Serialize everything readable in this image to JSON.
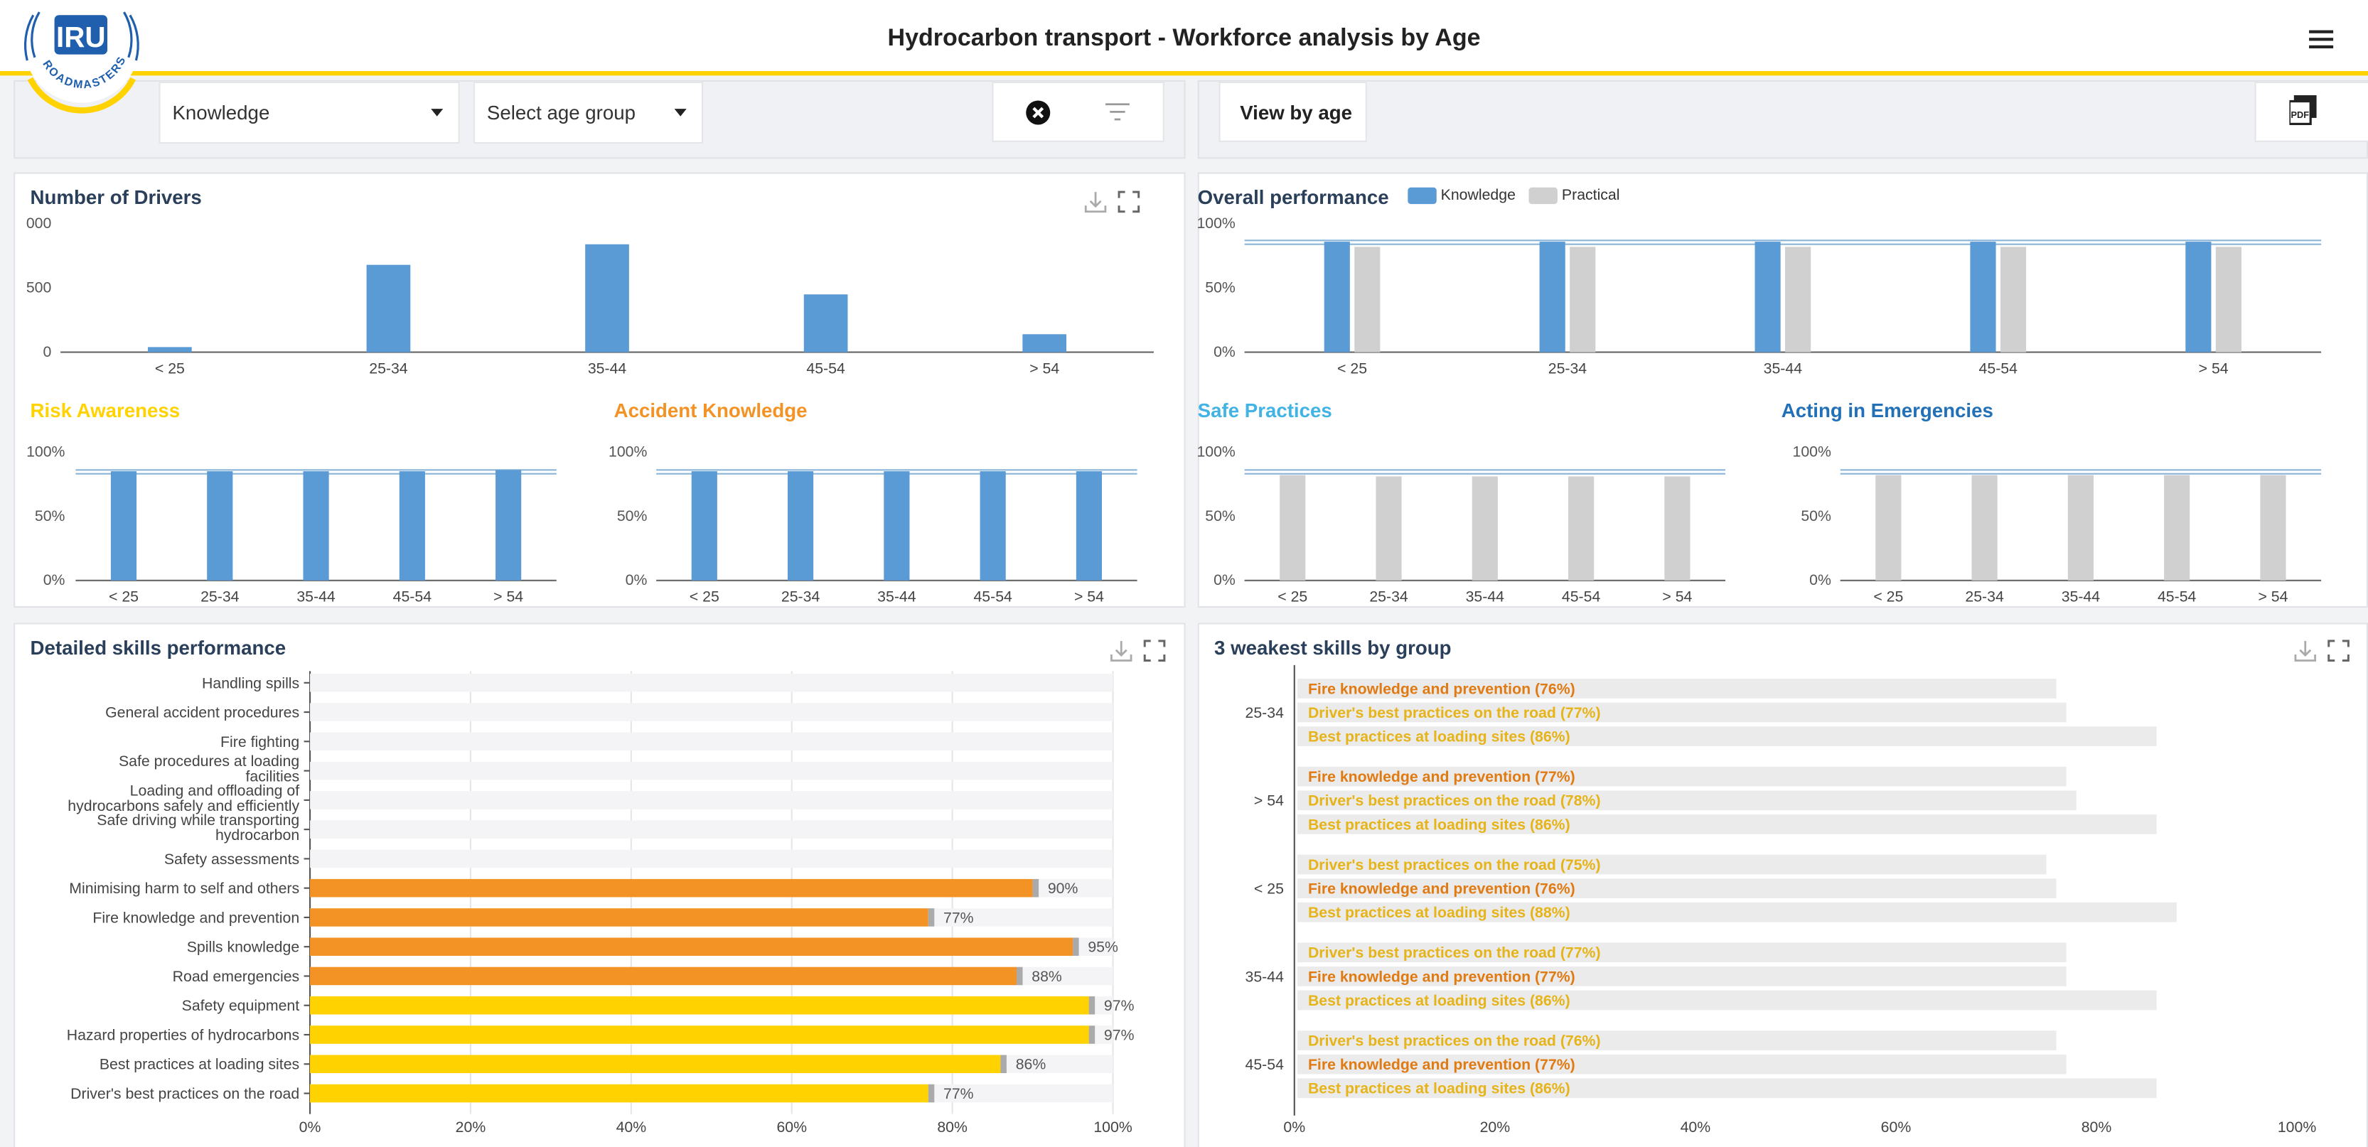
{
  "app": {
    "title": "Hydrocarbon transport - Workforce analysis by Age",
    "logo_text": "IRU",
    "logo_sub": "ROADMASTERS"
  },
  "filters": {
    "category": "Knowledge",
    "age_placeholder": "Select age group",
    "view_by_age": "View by age"
  },
  "colors": {
    "blue": "#5b9bd5",
    "gray": "#d0d0d0",
    "orange": "#f39325",
    "yellow": "#ffd200",
    "risk": "#ffd200",
    "accident": "#f39325",
    "safe": "#42b3e5",
    "emergency": "#2271b8"
  },
  "number_of_drivers": {
    "title": "Number of Drivers",
    "chart_data": {
      "type": "bar",
      "categories": [
        "< 25",
        "25-34",
        "35-44",
        "45-54",
        "> 54"
      ],
      "values": [
        40,
        680,
        840,
        450,
        140
      ],
      "ylim": [
        0,
        1000
      ],
      "yticks": [
        "0",
        "500",
        "000"
      ]
    }
  },
  "overall_performance": {
    "title": "Overall performance",
    "legend": [
      "Knowledge",
      "Practical"
    ],
    "chart_data": {
      "type": "bar",
      "categories": [
        "< 25",
        "25-34",
        "35-44",
        "45-54",
        "> 54"
      ],
      "series": [
        {
          "name": "Knowledge",
          "values": [
            86,
            86,
            86,
            86,
            86
          ]
        },
        {
          "name": "Practical",
          "values": [
            82,
            82,
            82,
            82,
            82
          ]
        }
      ],
      "ylim": [
        0,
        100
      ],
      "yticks": [
        "0%",
        "50%",
        "100%"
      ],
      "reference_lines": [
        87,
        84
      ]
    }
  },
  "small_charts": [
    {
      "title": "Risk Awareness",
      "color_key": "risk",
      "bar_color": "#5b9bd5",
      "chart_data": {
        "type": "bar",
        "categories": [
          "< 25",
          "25-34",
          "35-44",
          "45-54",
          "> 54"
        ],
        "values": [
          85,
          85,
          85,
          85,
          86
        ],
        "ylim": [
          0,
          100
        ],
        "yticks": [
          "0%",
          "50%",
          "100%"
        ],
        "reference_lines": [
          86,
          83
        ]
      }
    },
    {
      "title": "Accident Knowledge",
      "color_key": "accident",
      "bar_color": "#5b9bd5",
      "chart_data": {
        "type": "bar",
        "categories": [
          "< 25",
          "25-34",
          "35-44",
          "45-54",
          "> 54"
        ],
        "values": [
          85,
          85,
          85,
          85,
          85
        ],
        "ylim": [
          0,
          100
        ],
        "yticks": [
          "0%",
          "50%",
          "100%"
        ],
        "reference_lines": [
          86,
          83
        ]
      }
    },
    {
      "title": "Safe Practices",
      "color_key": "safe",
      "bar_color": "#d0d0d0",
      "chart_data": {
        "type": "bar",
        "categories": [
          "< 25",
          "25-34",
          "35-44",
          "45-54",
          "> 54"
        ],
        "values": [
          82,
          81,
          81,
          81,
          81
        ],
        "ylim": [
          0,
          100
        ],
        "yticks": [
          "0%",
          "50%",
          "100%"
        ],
        "reference_lines": [
          86,
          83
        ]
      }
    },
    {
      "title": "Acting in Emergencies",
      "color_key": "emergency",
      "bar_color": "#d0d0d0",
      "chart_data": {
        "type": "bar",
        "categories": [
          "< 25",
          "25-34",
          "35-44",
          "45-54",
          "> 54"
        ],
        "values": [
          82,
          82,
          82,
          82,
          82
        ],
        "ylim": [
          0,
          100
        ],
        "yticks": [
          "0%",
          "50%",
          "100%"
        ],
        "reference_lines": [
          86,
          83
        ]
      }
    }
  ],
  "detailed_skills": {
    "title": "Detailed skills performance",
    "chart_data": {
      "type": "bar",
      "orientation": "horizontal",
      "xticks": [
        "0%",
        "20%",
        "40%",
        "60%",
        "80%",
        "100%"
      ],
      "xlim": [
        0,
        100
      ],
      "rows": [
        {
          "label": [
            "Handling spills"
          ],
          "value": null,
          "color": "orange"
        },
        {
          "label": [
            "General accident procedures"
          ],
          "value": null,
          "color": "orange"
        },
        {
          "label": [
            "Fire fighting"
          ],
          "value": null,
          "color": "orange"
        },
        {
          "label": [
            "Safe procedures at loading",
            "facilities"
          ],
          "value": null,
          "color": "orange"
        },
        {
          "label": [
            "Loading and offloading of",
            "hydrocarbons safely and efficiently"
          ],
          "value": null,
          "color": "orange"
        },
        {
          "label": [
            "Safe driving while transporting",
            "hydrocarbon"
          ],
          "value": null,
          "color": "orange"
        },
        {
          "label": [
            "Safety assessments"
          ],
          "value": null,
          "color": "orange"
        },
        {
          "label": [
            "Minimising harm to self and others"
          ],
          "value": 90,
          "text": "90%",
          "color": "orange"
        },
        {
          "label": [
            "Fire knowledge and prevention"
          ],
          "value": 77,
          "text": "77%",
          "color": "orange"
        },
        {
          "label": [
            "Spills knowledge"
          ],
          "value": 95,
          "text": "95%",
          "color": "orange"
        },
        {
          "label": [
            "Road emergencies"
          ],
          "value": 88,
          "text": "88%",
          "color": "orange"
        },
        {
          "label": [
            "Safety equipment"
          ],
          "value": 97,
          "text": "97%",
          "color": "yellow"
        },
        {
          "label": [
            "Hazard properties of hydrocarbons"
          ],
          "value": 97,
          "text": "97%",
          "color": "yellow"
        },
        {
          "label": [
            "Best practices at loading sites"
          ],
          "value": 86,
          "text": "86%",
          "color": "yellow"
        },
        {
          "label": [
            "Driver's best practices on the road"
          ],
          "value": 77,
          "text": "77%",
          "color": "yellow"
        }
      ]
    }
  },
  "weakest_skills": {
    "title": "3 weakest skills by group",
    "chart_data": {
      "type": "bar",
      "orientation": "horizontal",
      "xticks": [
        "0%",
        "20%",
        "40%",
        "60%",
        "80%",
        "100%"
      ],
      "xlim": [
        0,
        100
      ],
      "groups": [
        {
          "group": "25-34",
          "items": [
            {
              "label": "Fire knowledge and prevention (76%)",
              "value": 76,
              "color": "orange"
            },
            {
              "label": "Driver's best practices on the road (77%)",
              "value": 77,
              "color": "yellow"
            },
            {
              "label": "Best practices at loading sites (86%)",
              "value": 86,
              "color": "yellow"
            }
          ]
        },
        {
          "group": "> 54",
          "items": [
            {
              "label": "Fire knowledge and prevention (77%)",
              "value": 77,
              "color": "orange"
            },
            {
              "label": "Driver's best practices on the road (78%)",
              "value": 78,
              "color": "yellow"
            },
            {
              "label": "Best practices at loading sites (86%)",
              "value": 86,
              "color": "yellow"
            }
          ]
        },
        {
          "group": "< 25",
          "items": [
            {
              "label": "Driver's best practices on the road (75%)",
              "value": 75,
              "color": "yellow"
            },
            {
              "label": "Fire knowledge and prevention (76%)",
              "value": 76,
              "color": "orange"
            },
            {
              "label": "Best practices at loading sites (88%)",
              "value": 88,
              "color": "yellow"
            }
          ]
        },
        {
          "group": "35-44",
          "items": [
            {
              "label": "Driver's best practices on the road (77%)",
              "value": 77,
              "color": "yellow"
            },
            {
              "label": "Fire knowledge and prevention (77%)",
              "value": 77,
              "color": "orange"
            },
            {
              "label": "Best practices at loading sites (86%)",
              "value": 86,
              "color": "yellow"
            }
          ]
        },
        {
          "group": "45-54",
          "items": [
            {
              "label": "Driver's best practices on the road (76%)",
              "value": 76,
              "color": "yellow"
            },
            {
              "label": "Fire knowledge and prevention (77%)",
              "value": 77,
              "color": "orange"
            },
            {
              "label": "Best practices at loading sites (86%)",
              "value": 86,
              "color": "yellow"
            }
          ]
        }
      ]
    }
  }
}
